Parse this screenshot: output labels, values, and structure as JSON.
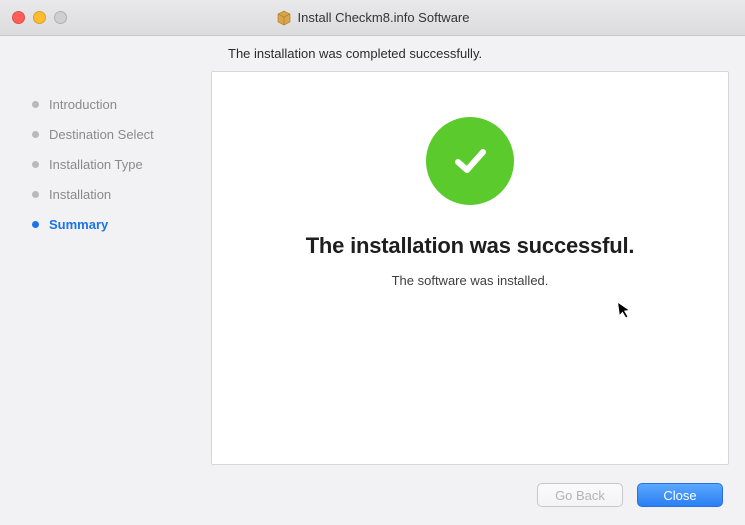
{
  "titlebar": {
    "title": "Install Checkm8.info Software"
  },
  "subheader": "The installation was completed successfully.",
  "sidebar": {
    "steps": [
      {
        "label": "Introduction",
        "active": false
      },
      {
        "label": "Destination Select",
        "active": false
      },
      {
        "label": "Installation Type",
        "active": false
      },
      {
        "label": "Installation",
        "active": false
      },
      {
        "label": "Summary",
        "active": true
      }
    ]
  },
  "main": {
    "headline": "The installation was successful.",
    "subline": "The software was installed."
  },
  "footer": {
    "go_back_label": "Go Back",
    "close_label": "Close"
  },
  "colors": {
    "success_green": "#5bca2c",
    "primary_blue": "#2a7ff3"
  },
  "icons": {
    "pkg": "package-icon",
    "check": "checkmark-icon",
    "cursor": "cursor-icon"
  }
}
